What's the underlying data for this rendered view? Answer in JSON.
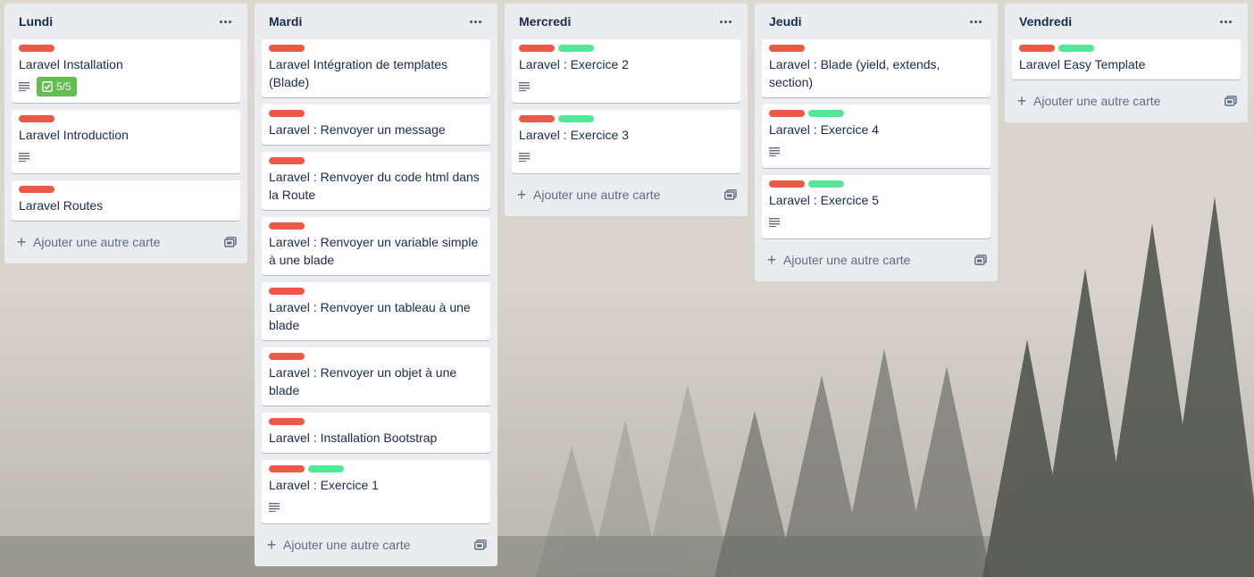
{
  "colors": {
    "label_red": "#eb5a46",
    "label_green": "#51e898",
    "checklist_done": "#61bd4f"
  },
  "add_card_label": "Ajouter une autre carte",
  "lists": [
    {
      "title": "Lundi",
      "cards": [
        {
          "title": "Laravel Installation",
          "labels": [
            "red"
          ],
          "description": true,
          "checklist": "5/5"
        },
        {
          "title": "Laravel Introduction",
          "labels": [
            "red"
          ],
          "description": true
        },
        {
          "title": "Laravel Routes",
          "labels": [
            "red"
          ]
        }
      ]
    },
    {
      "title": "Mardi",
      "cards": [
        {
          "title": "Laravel Intégration de templates (Blade)",
          "labels": [
            "red"
          ]
        },
        {
          "title": "Laravel : Renvoyer un message",
          "labels": [
            "red"
          ]
        },
        {
          "title": "Laravel : Renvoyer du code html dans la Route",
          "labels": [
            "red"
          ]
        },
        {
          "title": "Laravel : Renvoyer un variable simple à une blade",
          "labels": [
            "red"
          ]
        },
        {
          "title": "Laravel : Renvoyer un tableau à une blade",
          "labels": [
            "red"
          ]
        },
        {
          "title": "Laravel : Renvoyer un objet à une blade",
          "labels": [
            "red"
          ]
        },
        {
          "title": "Laravel : Installation Bootstrap",
          "labels": [
            "red"
          ]
        },
        {
          "title": "Laravel : Exercice 1",
          "labels": [
            "red",
            "green"
          ],
          "description": true
        }
      ]
    },
    {
      "title": "Mercredi",
      "cards": [
        {
          "title": "Laravel : Exercice 2",
          "labels": [
            "red",
            "green"
          ],
          "description": true
        },
        {
          "title": "Laravel : Exercice 3",
          "labels": [
            "red",
            "green"
          ],
          "description": true
        }
      ]
    },
    {
      "title": "Jeudi",
      "cards": [
        {
          "title": "Laravel : Blade (yield, extends, section)",
          "labels": [
            "red"
          ]
        },
        {
          "title": "Laravel : Exercice 4",
          "labels": [
            "red",
            "green"
          ],
          "description": true
        },
        {
          "title": "Laravel : Exercice 5",
          "labels": [
            "red",
            "green"
          ],
          "description": true
        }
      ]
    },
    {
      "title": "Vendredi",
      "cards": [
        {
          "title": "Laravel Easy Template",
          "labels": [
            "red",
            "green"
          ]
        }
      ]
    }
  ]
}
